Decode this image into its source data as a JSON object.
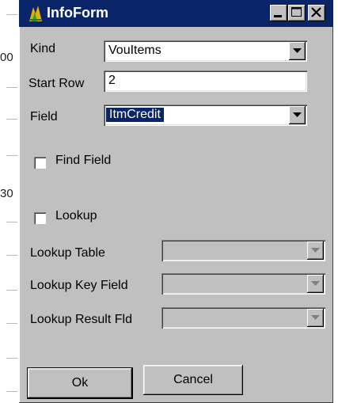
{
  "window": {
    "title": "InfoForm"
  },
  "background": {
    "char1": "00",
    "char2": "30"
  },
  "form": {
    "kind_label": "Kind",
    "kind_value": "VouItems",
    "start_row_label": "Start Row",
    "start_row_value": "2",
    "field_label": "Field",
    "field_value": "ItmCredit",
    "find_field_label": "Find Field",
    "find_field_checked": false,
    "lookup_label": "Lookup",
    "lookup_checked": false,
    "lookup_table_label": "Lookup Table",
    "lookup_table_value": "",
    "lookup_key_field_label": "Lookup Key Field",
    "lookup_key_field_value": "",
    "lookup_result_fld_label": "Lookup Result Fld",
    "lookup_result_fld_value": ""
  },
  "buttons": {
    "ok_label": "Ok",
    "cancel_label": "Cancel"
  },
  "colors": {
    "titlebar": "#0a246a",
    "face": "#c0c0c0",
    "selection": "#0a246a"
  }
}
